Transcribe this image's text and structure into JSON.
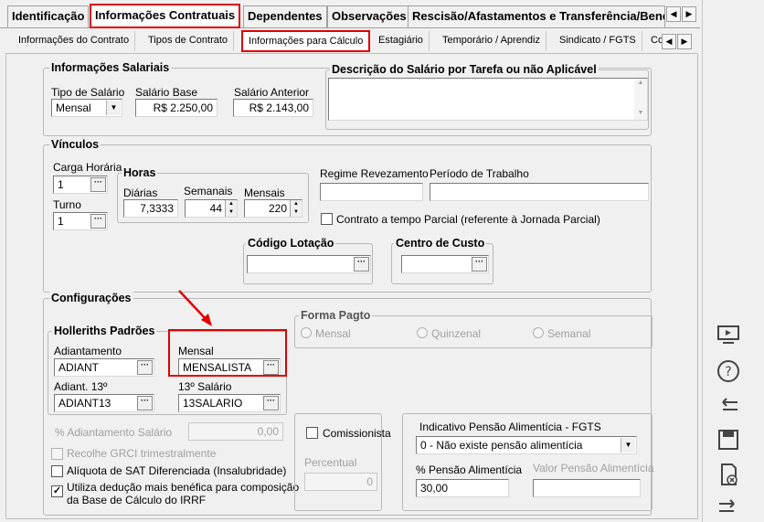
{
  "top_tabs": [
    {
      "label": "Identificação"
    },
    {
      "label": "Informações Contratuais"
    },
    {
      "label": "Dependentes"
    },
    {
      "label": "Observações"
    },
    {
      "label": "Rescisão/Afastamentos e Transferência/Bene"
    }
  ],
  "sub_tabs": [
    {
      "label": "Informações do Contrato"
    },
    {
      "label": "Tipos de Contrato"
    },
    {
      "label": "Informações para Cálculo"
    },
    {
      "label": "Estagiário"
    },
    {
      "label": "Temporário / Aprendiz"
    },
    {
      "label": "Sindicato / FGTS"
    },
    {
      "label": "Co"
    }
  ],
  "salariais": {
    "title": "Informações Salariais",
    "tipo_label": "Tipo de Salário",
    "tipo_value": "Mensal",
    "base_label": "Salário Base",
    "base_value": "R$ 2.250,00",
    "anterior_label": "Salário Anterior",
    "anterior_value": "R$ 2.143,00",
    "descricao_title": "Descrição do Salário por Tarefa ou não Aplicável",
    "descricao_value": ""
  },
  "vinculos": {
    "title": "Vínculos",
    "carga_label": "Carga Horária",
    "carga_value": "1",
    "turno_label": "Turno",
    "turno_value": "1",
    "horas_title": "Horas",
    "diarias_label": "Diárias",
    "diarias_value": "7,3333",
    "semanais_label": "Semanais",
    "semanais_value": "44",
    "mensais_label": "Mensais",
    "mensais_value": "220",
    "regime_label": "Regime Revezamento",
    "regime_value": "",
    "periodo_label": "Período de Trabalho",
    "periodo_value": "",
    "parcial_label": "Contrato a tempo Parcial (referente à Jornada Parcial)",
    "lotacao_title": "Código Lotação",
    "lotacao_value": "",
    "custo_title": "Centro de Custo",
    "custo_value": ""
  },
  "configuracoes": {
    "title": "Configurações",
    "holleriths_title": "Holleriths Padrões",
    "adiantamento_label": "Adiantamento",
    "adiantamento_value": "ADIANT",
    "mensal_label": "Mensal",
    "mensal_value": "MENSALISTA",
    "adiant13_label": "Adiant. 13º",
    "adiant13_value": "ADIANT13",
    "salario13_label": "13º Salário",
    "salario13_value": "13SALARIO",
    "forma_title": "Forma Pagto",
    "forma_options": [
      "Mensal",
      "Quinzenal",
      "Semanal"
    ],
    "perc_adiant_label": "% Adiantamento Salário",
    "perc_adiant_value": "0,00",
    "grci_label": "Recolhe GRCI trimestralmente",
    "sat_label": "Alíquota de SAT Diferenciada (Insalubridade)",
    "irrf_label_1": "Utiliza dedução mais benéfica para composição",
    "irrf_label_2": "da Base de Cálculo do IRRF",
    "comissionista_label": "Comissionista",
    "percentual_label": "Percentual",
    "percentual_value": "0",
    "pensao_indicativo_label": "Indicativo Pensão Alimentícia - FGTS",
    "pensao_indicativo_value": "0 - Não existe pensão alimentícia",
    "pensao_perc_label": "% Pensão Alimentícia",
    "pensao_perc_value": "30,00",
    "pensao_valor_label": "Valor Pensão Alimentícia",
    "pensao_valor_value": ""
  },
  "colors": {
    "highlight": "#e00000",
    "accent": "#e00000"
  }
}
